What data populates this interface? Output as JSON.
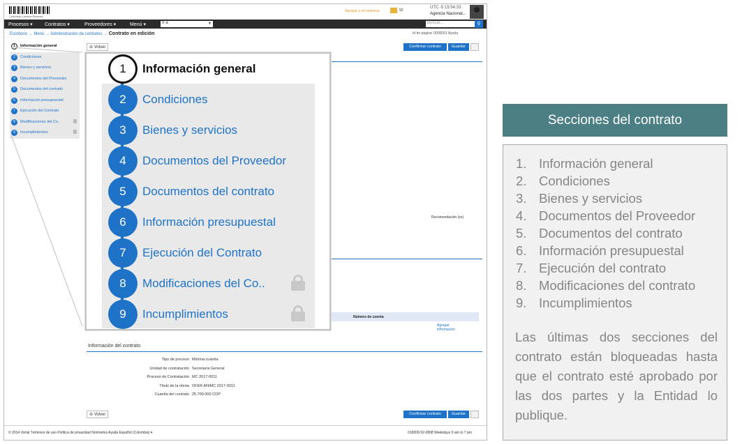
{
  "header": {
    "logo_sub": "Colombia Compra Eficiente",
    "link": "Agregar a mi empresa",
    "count": "92",
    "time": "UTC -5 15:54:33",
    "agency": "Agencia Nacional..."
  },
  "nav": {
    "items": [
      "Procesos ▾",
      "Contratos ▾",
      "Proveedores ▾",
      "Menú ▾"
    ],
    "goto": "Ir a",
    "search_placeholder": "Buscar..."
  },
  "breadcrumb": {
    "path": "Escritorio → Menú → Administración de contratos →",
    "current": "Contrato en edición",
    "right": "Id de página: 0000001   Ayuda"
  },
  "steps": [
    {
      "num": "1",
      "label": "Información general",
      "locked": false
    },
    {
      "num": "2",
      "label": "Condiciones",
      "locked": false
    },
    {
      "num": "3",
      "label": "Bienes y servicios",
      "locked": false
    },
    {
      "num": "4",
      "label": "Documentos del Proveedor",
      "locked": false
    },
    {
      "num": "5",
      "label": "Documentos del contrato",
      "locked": false
    },
    {
      "num": "6",
      "label": "Información presupuestal",
      "locked": false
    },
    {
      "num": "7",
      "label": "Ejecución del Contrato",
      "locked": false
    },
    {
      "num": "8",
      "label": "Modificaciones del Co..",
      "locked": true
    },
    {
      "num": "9",
      "label": "Incumplimientos",
      "locked": true
    }
  ],
  "buttons": {
    "volver": "Volver",
    "confirmar": "Confirmar contrato",
    "guardar": "Guardar"
  },
  "page": {
    "recommendation": "Recomendación (es)",
    "table_header": "Número de cuenta",
    "agregar": "Agregar información",
    "info_title": "Información del contrato",
    "info_rows": [
      {
        "k": "Tipo de proceso",
        "v": "Mínima cuantía"
      },
      {
        "k": "Unidad de contratación",
        "v": "Secretaría General"
      },
      {
        "k": "Proceso de Contratación",
        "v": "MC 2017-0011"
      },
      {
        "k": "Título de la oferta",
        "v": "OFER ANIMC 2017-0011"
      },
      {
        "k": "Cuantía del contrato",
        "v": "25.700.000 COP"
      }
    ]
  },
  "footer": {
    "left": "© 2014 Vortal   Términos de uso   Política de privacidad   Normativa   Ayuda   Español (Colombia) ▾",
    "right": "018000-52-0808    Weekdays 9 am to 7 pm"
  },
  "side_panel": {
    "title": "Secciones del contrato",
    "sections": [
      {
        "n": "1.",
        "label": "Información general"
      },
      {
        "n": "2.",
        "label": "Condiciones"
      },
      {
        "n": "3.",
        "label": "Bienes y servicios"
      },
      {
        "n": "4.",
        "label": "Documentos del Proveedor"
      },
      {
        "n": "5.",
        "label": "Documentos del contrato"
      },
      {
        "n": "6.",
        "label": "Información presupuestal"
      },
      {
        "n": "7.",
        "label": "Ejecución del contrato"
      },
      {
        "n": "8.",
        "label": "Modificaciones del contrato"
      },
      {
        "n": "9.",
        "label": "Incumplimientos"
      }
    ],
    "note": "Las últimas dos secciones del contrato están bloqueadas hasta que el contrato esté aprobado por las dos partes y la Entidad lo publique."
  },
  "colors": {
    "accent": "#1e73c8",
    "panel_title_bg": "#4c7f84",
    "panel_text": "#858585"
  }
}
